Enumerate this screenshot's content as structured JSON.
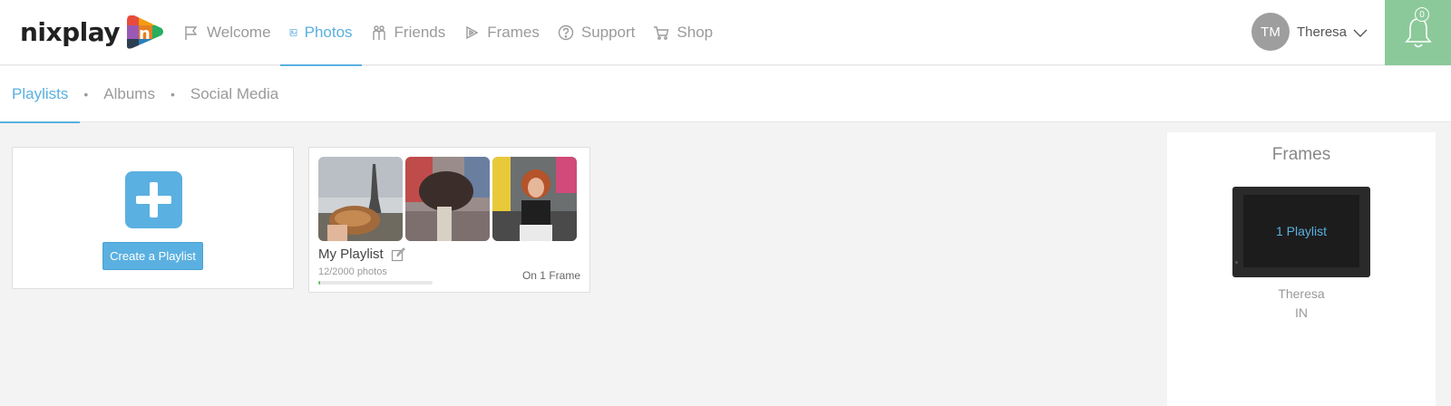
{
  "brand": {
    "logo_text": "nixplay"
  },
  "nav": {
    "items": [
      {
        "label": "Welcome",
        "icon": "flag-icon"
      },
      {
        "label": "Photos",
        "icon": "photo-icon"
      },
      {
        "label": "Friends",
        "icon": "friends-icon"
      },
      {
        "label": "Frames",
        "icon": "frame-icon"
      },
      {
        "label": "Support",
        "icon": "help-icon"
      },
      {
        "label": "Shop",
        "icon": "cart-icon"
      }
    ],
    "active": "Photos"
  },
  "user": {
    "initials": "TM",
    "name": "Theresa"
  },
  "notifications": {
    "count": "0"
  },
  "subnav": {
    "tabs": [
      {
        "label": "Playlists"
      },
      {
        "label": "Albums"
      },
      {
        "label": "Social Media"
      }
    ],
    "separator": "•",
    "active": "Playlists"
  },
  "create_card": {
    "button_label": "Create a Playlist"
  },
  "playlist": {
    "title": "My Playlist",
    "photo_count": "12/2000 photos",
    "frames_label": "On 1 Frame",
    "progress_fraction": 0.006
  },
  "frames_panel": {
    "title": "Frames",
    "frame": {
      "screen_label": "1 Playlist",
      "owner": "Theresa",
      "country": "IN"
    }
  },
  "colors": {
    "accent": "#5ab0e0",
    "bell_bg": "#8cc99a",
    "progress": "#6bbf6b"
  }
}
